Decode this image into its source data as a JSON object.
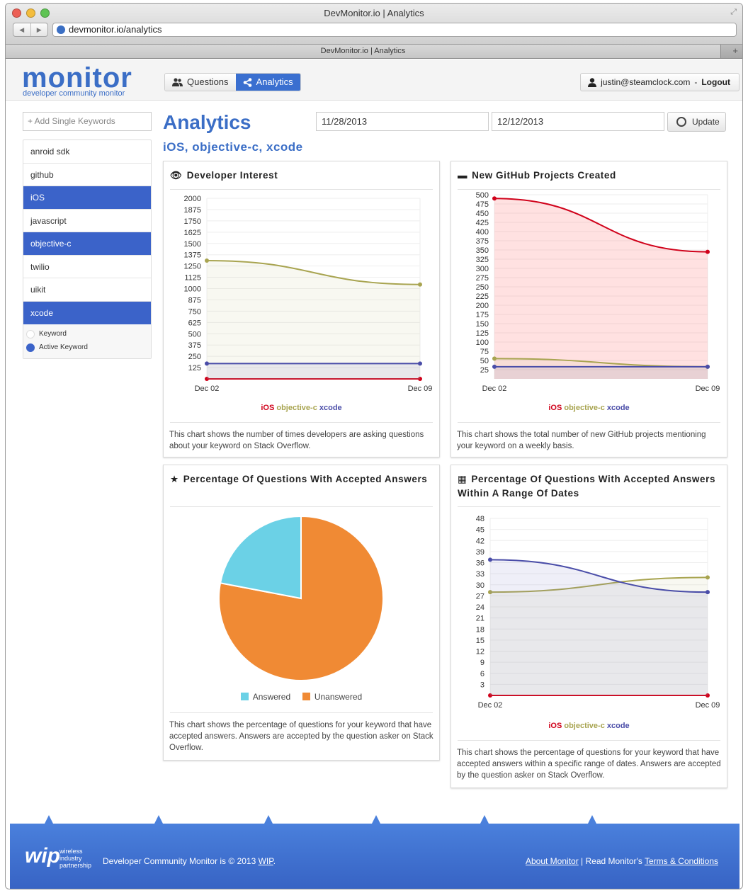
{
  "window": {
    "title": "DevMonitor.io | Analytics",
    "url": "devmonitor.io/analytics",
    "tab_title": "DevMonitor.io | Analytics"
  },
  "header": {
    "logo": "monitor",
    "logo_sub": "developer community monitor",
    "tabs": [
      {
        "label": "Questions",
        "icon": "users-icon"
      },
      {
        "label": "Analytics",
        "icon": "share-icon",
        "active": true
      }
    ],
    "user_email": "justin@steamclock.com",
    "separator": "-",
    "logout_label": "Logout"
  },
  "sidebar": {
    "add_placeholder": "+ Add Single Keywords",
    "keywords": [
      {
        "label": "anroid sdk",
        "active": false
      },
      {
        "label": "github",
        "active": false
      },
      {
        "label": "iOS",
        "active": true
      },
      {
        "label": "javascript",
        "active": false
      },
      {
        "label": "objective-c",
        "active": true
      },
      {
        "label": "twilio",
        "active": false
      },
      {
        "label": "uikit",
        "active": false
      },
      {
        "label": "xcode",
        "active": true
      }
    ],
    "legend_keyword": "Keyword",
    "legend_active": "Active Keyword"
  },
  "main": {
    "title": "Analytics",
    "subtitle": "iOS, objective-c, xcode",
    "date_from": "11/28/2013",
    "date_to": "12/12/2013",
    "update_label": "Update"
  },
  "series_legend": {
    "ios": "iOS",
    "objc": "objective-c",
    "xcode": "xcode"
  },
  "colors": {
    "ios": "#d0021b",
    "objc": "#a8a450",
    "xcode": "#4a4da8",
    "answered": "#6bd1e6",
    "unanswered": "#f08a34",
    "brand": "#3b6ec6"
  },
  "panels": {
    "interest": {
      "title": "Developer Interest",
      "icon": "eye-icon",
      "desc": "This chart shows the number of times developers are asking questions about your keyword on Stack Overflow."
    },
    "github": {
      "title": "New GitHub Projects Created",
      "icon": "folder-icon",
      "desc": "This chart shows the total number of new GitHub projects mentioning your keyword on a weekly basis."
    },
    "accepted": {
      "title": "Percentage Of Questions With Accepted Answers",
      "icon": "star-icon",
      "desc": "This chart shows the percentage of questions for your keyword that have accepted answers. Answers are accepted by the question asker on Stack Overflow."
    },
    "accepted_range": {
      "title": "Percentage Of Questions With Accepted Answers Within A Range Of Dates",
      "icon": "calendar-icon",
      "desc": "This chart shows the percentage of questions for your keyword that have accepted answers within a specific range of dates. Answers are accepted by the question asker on Stack Overflow."
    }
  },
  "chart_data": [
    {
      "type": "area",
      "title": "Developer Interest",
      "categories": [
        "Dec 02",
        "Dec 09"
      ],
      "yticks": [
        125,
        250,
        375,
        500,
        625,
        750,
        875,
        1000,
        1125,
        1250,
        1375,
        1500,
        1625,
        1750,
        1875,
        2000
      ],
      "ylim": [
        0,
        2000
      ],
      "series": [
        {
          "name": "iOS",
          "key": "ios",
          "values": [
            0,
            0
          ]
        },
        {
          "name": "objective-c",
          "key": "objc",
          "values": [
            1310,
            1045
          ]
        },
        {
          "name": "xcode",
          "key": "xcode",
          "values": [
            170,
            170
          ]
        }
      ]
    },
    {
      "type": "area",
      "title": "New GitHub Projects Created",
      "categories": [
        "Dec 02",
        "Dec 09"
      ],
      "yticks": [
        25,
        50,
        75,
        100,
        125,
        150,
        175,
        200,
        225,
        250,
        275,
        300,
        325,
        350,
        375,
        400,
        425,
        450,
        475,
        500
      ],
      "ylim": [
        0,
        500
      ],
      "series": [
        {
          "name": "iOS",
          "key": "ios",
          "values": [
            490,
            345
          ]
        },
        {
          "name": "objective-c",
          "key": "objc",
          "values": [
            55,
            33
          ]
        },
        {
          "name": "xcode",
          "key": "xcode",
          "values": [
            33,
            33
          ]
        }
      ]
    },
    {
      "type": "pie",
      "title": "Percentage Of Questions With Accepted Answers",
      "slices": [
        {
          "name": "Answered",
          "value": 22,
          "key": "answered"
        },
        {
          "name": "Unanswered",
          "value": 78,
          "key": "unanswered"
        }
      ]
    },
    {
      "type": "area",
      "title": "Percentage Of Questions With Accepted Answers Within A Range Of Dates",
      "categories": [
        "Dec 02",
        "Dec 09"
      ],
      "yticks": [
        3,
        6,
        9,
        12,
        15,
        18,
        21,
        24,
        27,
        30,
        33,
        36,
        39,
        42,
        45,
        48
      ],
      "ylim": [
        0,
        48
      ],
      "series": [
        {
          "name": "iOS",
          "key": "ios",
          "values": [
            0,
            0
          ]
        },
        {
          "name": "objective-c",
          "key": "objc",
          "values": [
            28,
            32
          ]
        },
        {
          "name": "xcode",
          "key": "xcode",
          "values": [
            36.8,
            28
          ]
        }
      ]
    }
  ],
  "footer": {
    "logo": "wip",
    "logo_sub1": "wireless",
    "logo_sub2": "industry",
    "logo_sub3": "partnership",
    "copyright_prefix": "Developer Community Monitor is © 2013 ",
    "copyright_link": "WIP",
    "copyright_suffix": ".",
    "about_link": "About Monitor",
    "sep": " | ",
    "terms_prefix": "Read Monitor's ",
    "terms_link": "Terms & Conditions"
  }
}
